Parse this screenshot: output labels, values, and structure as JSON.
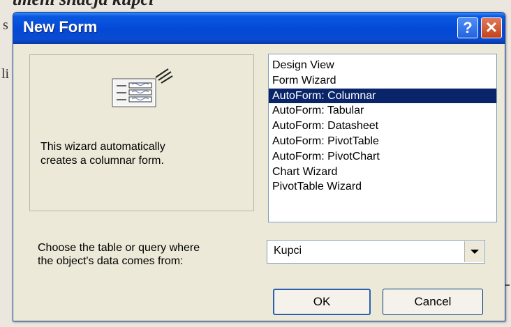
{
  "background": {
    "top_text": "tmeni snacja kupci",
    "left_letter_1": "s",
    "left_letter_2": "li"
  },
  "dialog": {
    "title": "New Form",
    "help_icon": "?",
    "close_icon": "✕",
    "preview": {
      "icon": "form-wizard-icon",
      "description": "This wizard automatically\ncreates a columnar form."
    },
    "list": {
      "items": [
        "Design View",
        "Form Wizard",
        "AutoForm:  Columnar",
        "AutoForm:  Tabular",
        "AutoForm:  Datasheet",
        "AutoForm:  PivotTable",
        "AutoForm:  PivotChart",
        "Chart Wizard",
        "PivotTable Wizard"
      ],
      "selected_index": 2
    },
    "choose_label": "Choose the table or query where\nthe object's data comes from:",
    "combo": {
      "value": "Kupci"
    },
    "buttons": {
      "ok": "OK",
      "cancel": "Cancel"
    }
  },
  "colors": {
    "title_bar": "#0449d6",
    "selection": "#0a246a",
    "dialog_bg": "#ece9d8"
  }
}
